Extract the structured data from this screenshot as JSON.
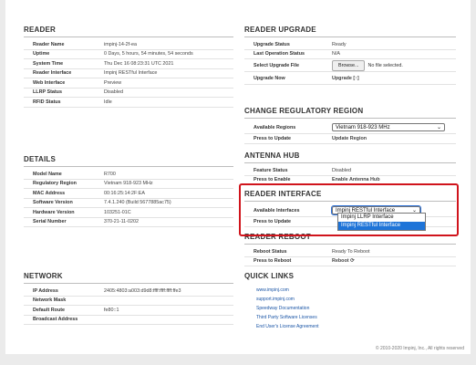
{
  "reader": {
    "title": "READER",
    "rows": [
      {
        "label": "Reader Name",
        "value": "impinj-14-2f-ea"
      },
      {
        "label": "Uptime",
        "value": "0 Days, 5 hours, 54 minutes, 54 seconds"
      },
      {
        "label": "System Time",
        "value": "Thu Dec 16 08:23:31 UTC 2021"
      },
      {
        "label": "Reader Interface",
        "value": "Impinj RESTful Interface"
      },
      {
        "label": "Web Interface",
        "value": "Preview"
      },
      {
        "label": "LLRP Status",
        "value": "Disabled"
      },
      {
        "label": "RFID Status",
        "value": "Idle"
      }
    ]
  },
  "details": {
    "title": "DETAILS",
    "rows": [
      {
        "label": "Model Name",
        "value": "R700"
      },
      {
        "label": "Regulatory Region",
        "value": "Vietnam 918-923 MHz"
      },
      {
        "label": "MAC Address",
        "value": "00:16:25:14:2F:EA"
      },
      {
        "label": "Software Version",
        "value": "7.4.1.240 (Build 5677885ac75)"
      },
      {
        "label": "Hardware Version",
        "value": "103251-01C"
      },
      {
        "label": "Serial Number",
        "value": "370-21-11-0202"
      }
    ]
  },
  "network": {
    "title": "NETWORK",
    "rows": [
      {
        "label": "IP Address",
        "value": "2405:4803:a003:d9d8:ffff:ffff:ffff:ffe3"
      },
      {
        "label": "Network Mask",
        "value": ""
      },
      {
        "label": "Default Route",
        "value": "fe80::1"
      },
      {
        "label": "Broadcast Address",
        "value": ""
      }
    ]
  },
  "upgrade": {
    "title": "READER UPGRADE",
    "status_label": "Upgrade Status",
    "status_value": "Ready",
    "last_op_label": "Last Operation Status",
    "last_op_value": "N/A",
    "select_label": "Select Upgrade File",
    "browse_label": "Browse...",
    "no_file": "No file selected.",
    "upgrade_now_label": "Upgrade Now",
    "upgrade_link": "Upgrade"
  },
  "regulatory": {
    "title": "CHANGE REGULATORY REGION",
    "available_label": "Available Regions",
    "selected_region": "Vietnam 918-923 MHz",
    "press_label": "Press to Update",
    "update_link": "Update Region"
  },
  "antenna": {
    "title": "ANTENNA HUB",
    "feature_label": "Feature Status",
    "feature_value": "Disabled",
    "press_label": "Press to Enable",
    "enable_link": "Enable Antenna Hub"
  },
  "interface": {
    "title": "READER INTERFACE",
    "available_label": "Available Interfaces",
    "selected": "Impinj RESTful Interface",
    "press_label": "Press to Update",
    "options": [
      "Impinj LLRP Interface",
      "Impinj RESTful Interface"
    ],
    "selected_option_index": 1,
    "highlight_color": "#d0141c"
  },
  "reboot": {
    "title": "READER REBOOT",
    "status_label": "Reboot Status",
    "status_value": "Ready To Reboot",
    "press_label": "Press to Reboot",
    "reboot_link": "Reboot"
  },
  "quick_links": {
    "title": "QUICK LINKS",
    "links": [
      "www.impinj.com",
      "support.impinj.com",
      "Speedway Documentation",
      "Third Party Software Licenses",
      "End User's License Agreement"
    ]
  },
  "footer": "© 2010-2020 Impinj, Inc., All rights reserved",
  "colors": {
    "link": "#1a55a6",
    "highlight": "#d0141c",
    "option_selected": "#1e74d8"
  }
}
